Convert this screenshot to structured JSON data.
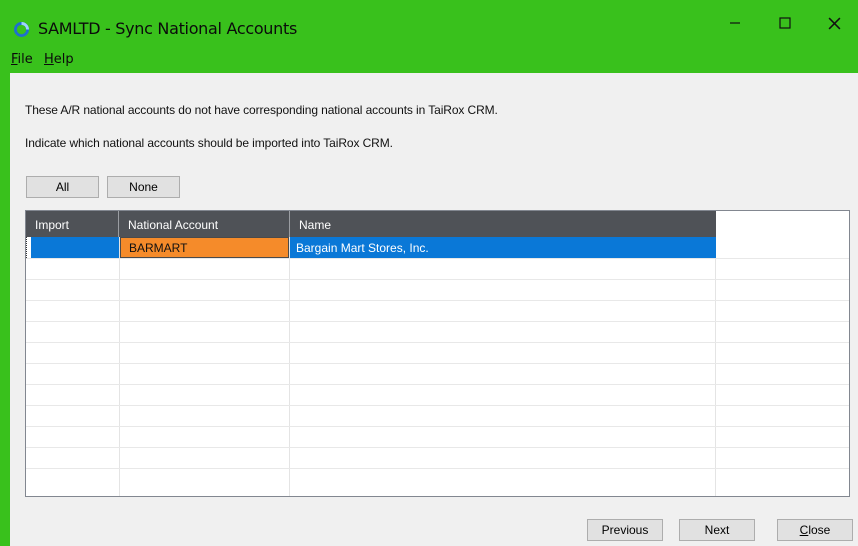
{
  "window": {
    "title": "SAMLTD - Sync National Accounts",
    "accent_color": "#39c11c",
    "icon": "app-sync-icon",
    "controls": [
      "minimize-icon",
      "maximize-icon",
      "close-icon"
    ]
  },
  "menu": {
    "file": {
      "accel": "F",
      "rest": "ile"
    },
    "help": {
      "accel": "H",
      "rest": "elp"
    }
  },
  "messages": {
    "line1": "These A/R national accounts do not have corresponding national accounts in TaiRox CRM.",
    "line2": "Indicate which national accounts should be imported into TaiRox CRM."
  },
  "selection_buttons": {
    "all": "All",
    "none": "None"
  },
  "grid": {
    "columns": [
      "Import",
      "National Account",
      "Name"
    ],
    "rows": [
      {
        "import": "",
        "national_account": "BARMART",
        "name": "Bargain Mart Stores, Inc."
      }
    ],
    "selected_color": "#0a78d7",
    "active_cell_color": "#f58b2a"
  },
  "footer": {
    "previous": "Previous",
    "next": "Next",
    "close": {
      "accel": "C",
      "rest": "lose"
    }
  }
}
